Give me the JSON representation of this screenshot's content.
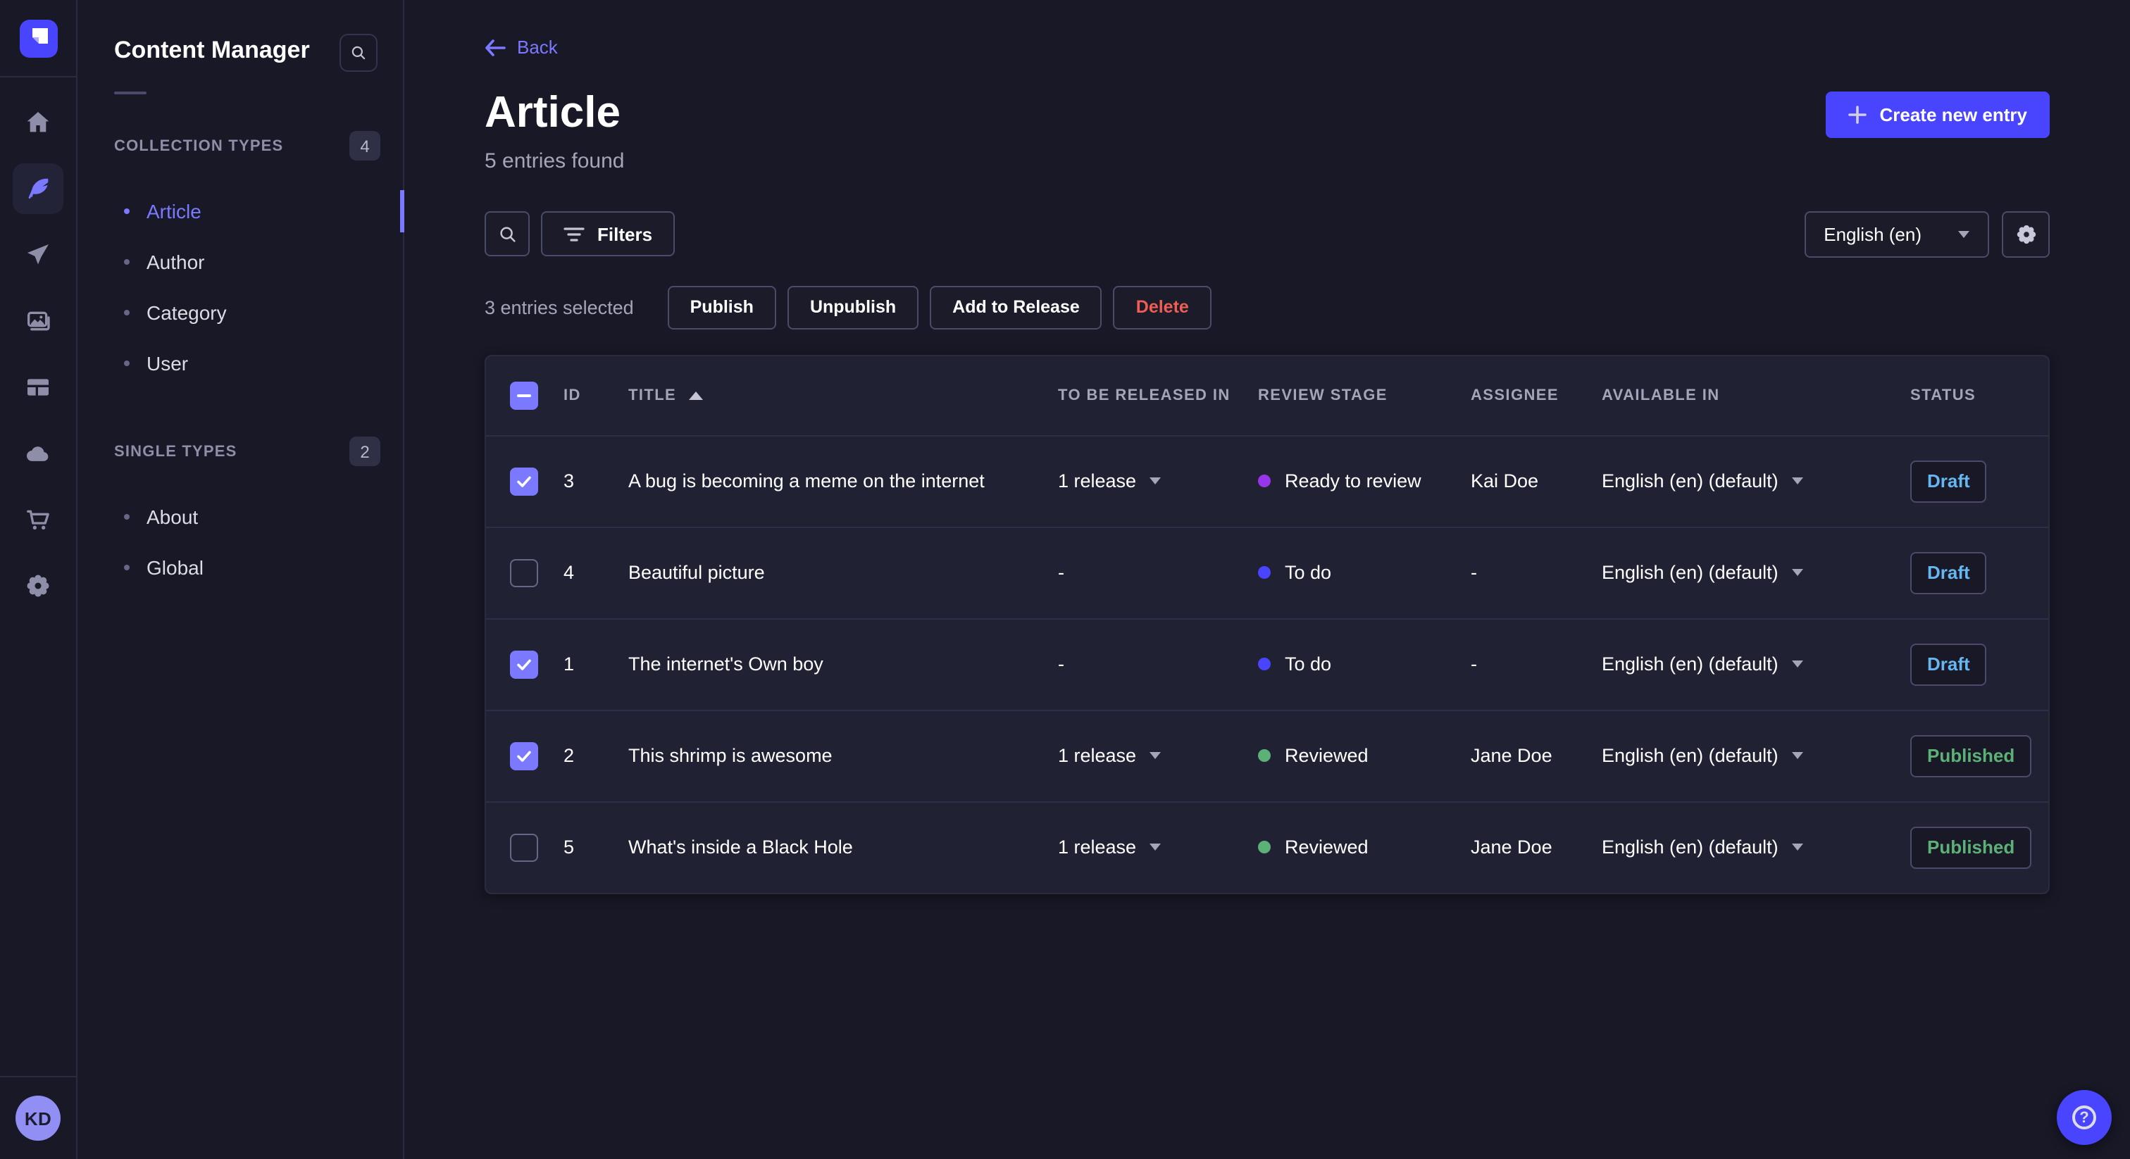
{
  "app": {
    "rail_icons": [
      "home",
      "content-manager-feather",
      "send-plane",
      "media-library-images",
      "content-type-builder-layout",
      "cloud",
      "marketplace-cart",
      "settings-gear"
    ],
    "user_initials": "KD",
    "help_glyph": "?"
  },
  "subnav": {
    "title": "Content Manager",
    "sections": [
      {
        "label": "COLLECTION TYPES",
        "count": "4",
        "items": [
          {
            "label": "Article",
            "active": true
          },
          {
            "label": "Author",
            "active": false
          },
          {
            "label": "Category",
            "active": false
          },
          {
            "label": "User",
            "active": false
          }
        ]
      },
      {
        "label": "SINGLE TYPES",
        "count": "2",
        "items": [
          {
            "label": "About",
            "active": false
          },
          {
            "label": "Global",
            "active": false
          }
        ]
      }
    ]
  },
  "header": {
    "back": "Back",
    "title": "Article",
    "subtitle": "5 entries found",
    "create_button": "Create new entry"
  },
  "toolbar": {
    "filters": "Filters",
    "locale": "English (en)"
  },
  "selection": {
    "text": "3 entries selected",
    "publish": "Publish",
    "unpublish": "Unpublish",
    "add_to_release": "Add to Release",
    "delete": "Delete"
  },
  "table": {
    "columns": [
      "ID",
      "TITLE",
      "TO BE RELEASED IN",
      "REVIEW STAGE",
      "ASSIGNEE",
      "AVAILABLE IN",
      "STATUS"
    ],
    "rows": [
      {
        "checked": true,
        "id": "3",
        "title": "A bug is becoming a meme on the internet",
        "release": "1 release",
        "stage": "Ready to review",
        "stage_color": "#9736e8",
        "assignee": "Kai Doe",
        "locale": "English (en) (default)",
        "status": "Draft"
      },
      {
        "checked": false,
        "id": "4",
        "title": "Beautiful picture",
        "release": "-",
        "stage": "To do",
        "stage_color": "#4945ff",
        "assignee": "-",
        "locale": "English (en) (default)",
        "status": "Draft"
      },
      {
        "checked": true,
        "id": "1",
        "title": "The internet's Own boy",
        "release": "-",
        "stage": "To do",
        "stage_color": "#4945ff",
        "assignee": "-",
        "locale": "English (en) (default)",
        "status": "Draft"
      },
      {
        "checked": true,
        "id": "2",
        "title": "This shrimp is awesome",
        "release": "1 release",
        "stage": "Reviewed",
        "stage_color": "#5cb176",
        "assignee": "Jane Doe",
        "locale": "English (en) (default)",
        "status": "Published"
      },
      {
        "checked": false,
        "id": "5",
        "title": "What's inside a Black Hole",
        "release": "1 release",
        "stage": "Reviewed",
        "stage_color": "#5cb176",
        "assignee": "Jane Doe",
        "locale": "English (en) (default)",
        "status": "Published"
      }
    ]
  },
  "colors": {
    "page_bg": "#181826",
    "panel_bg": "#212134",
    "primary": "#4945ff",
    "primary_light": "#7b79ff",
    "muted_text": "#a5a5ba",
    "border": "#4a4a6a",
    "danger": "#ee5e52",
    "success": "#5cb176",
    "draft_blue": "#66b7f1",
    "stage_purple": "#9736e8"
  }
}
